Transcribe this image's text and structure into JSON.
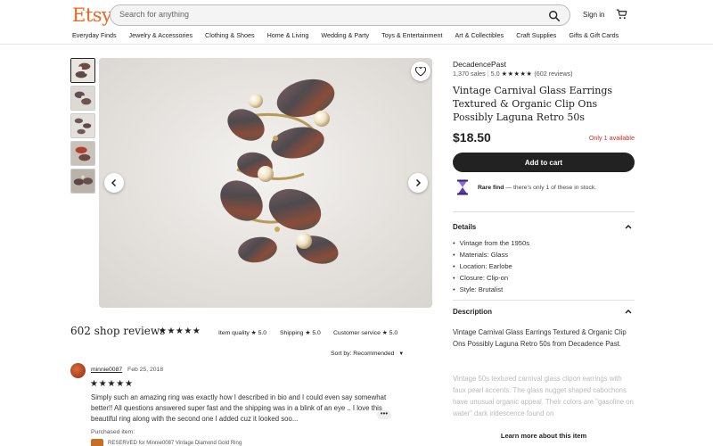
{
  "header": {
    "logo": "Etsy",
    "search_placeholder": "Search for anything",
    "signin": "Sign in",
    "categories": [
      "Everyday Finds",
      "Jewelry & Accessories",
      "Clothing & Shoes",
      "Home & Living",
      "Wedding & Party",
      "Toys & Entertainment",
      "Art & Collectibles",
      "Craft Supplies",
      "Gifts & Gift Cards"
    ]
  },
  "listing": {
    "shop_name": "DecadencePast",
    "sales": "1,370 sales",
    "rating": "5.0",
    "stars": "★★★★★",
    "review_count": "(602 reviews)",
    "title": "Vintage Carnival Glass Earrings Textured & Organic Clip Ons Possibly Laguna Retro 50s",
    "price": "$18.50",
    "availability": "Only 1 available",
    "add_to_cart": "Add to cart",
    "rare_title": "Rare find",
    "rare_text": " — there's only 1 of these in stock.",
    "details_heading": "Details",
    "details": [
      "Vintage from the 1950s",
      "Materials: Glass",
      "Location: Earlobe",
      "Closure: Clip-on",
      "Style: Brutalist"
    ],
    "description_heading": "Description",
    "description": "Vintage Carnival Glass Earrings Textured & Organic Clip Ons Possibly Laguna Retro 50s from Decadence Past.",
    "description_more": "Vintage 50s textured carnival glass clipon earrings with faux pearl accents. The glass nugget shaped cabochons have unusual organic appeal. Their colors are \"gasoline on water\" dark iridescence found on",
    "learn_more": "Learn more about this item"
  },
  "reviews": {
    "count": "602 shop reviews",
    "stars": "★★★★★",
    "item_quality_label": "Item quality",
    "item_quality": "★ 5.0",
    "shipping_label": "Shipping",
    "shipping": "★ 5.0",
    "customer_service_label": "Customer service",
    "customer_service": "★ 5.0",
    "sort_label": "Sort by: Recommended",
    "items": [
      {
        "reviewer": "minnie0087",
        "date": "Feb 25, 2018",
        "stars": "★★★★★",
        "text": "Simply such an amazing ring was exactly how I described in bio and I could even say somewhat better!! All questions answered super fast and the shipping was in a blink of an eye .. I love this beautiful ring along with the second one I added cuz it looked soo...",
        "purchased_label": "Purchased item:",
        "purchased_item": "RESERVED for Minnie0087 Vintage Diamond Gold Ring"
      }
    ]
  },
  "colors": {
    "brand": "#f1641e",
    "alert": "#d92b1b",
    "button": "#222222"
  }
}
